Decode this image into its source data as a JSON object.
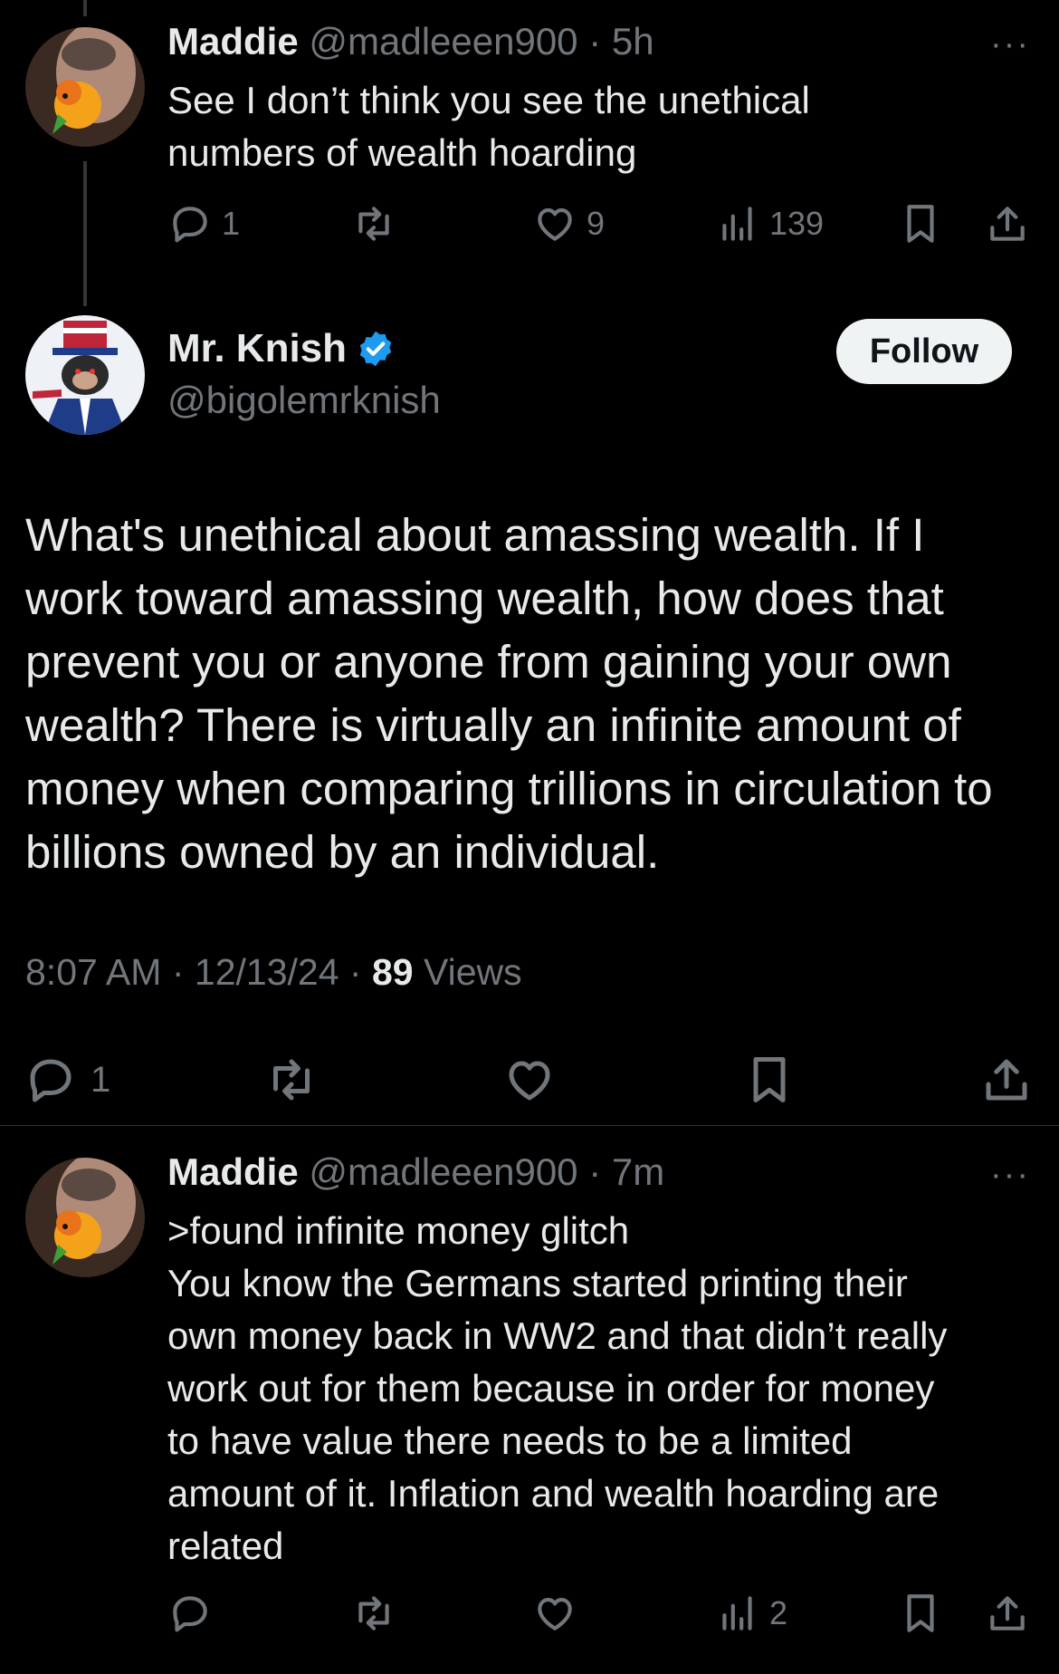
{
  "reply1": {
    "name": "Maddie",
    "handle": "@madleeen900",
    "time": "5h",
    "text_lines": [
      "See I don’t think you see the unethical",
      "numbers of wealth hoarding"
    ],
    "more": "···",
    "reply_count": "1",
    "like_count": "9",
    "view_count": "139"
  },
  "main": {
    "name": "Mr. Knish",
    "handle": "@bigolemrknish",
    "follow_label": "Follow",
    "text": "What's unethical about amassing wealth.  If I work toward amassing wealth, how does that prevent you or anyone from gaining your own wealth?  There is virtually an infinite amount of money when comparing trillions in circulation to billions owned by an individual.",
    "time": "8:07 AM",
    "date": "12/13/24",
    "views_count": "89",
    "views_label": "Views",
    "reply_count": "1",
    "verified_color": "#1d9bf0"
  },
  "reply2": {
    "name": "Maddie",
    "handle": "@madleeen900",
    "time": "7m",
    "text_lines": [
      ">found infinite money glitch",
      "You know the Germans started printing their",
      "own money back in WW2 and that didn’t really",
      "work out for them because in order for money",
      "to have value there needs to be a limited",
      "amount of it. Inflation and wealth hoarding are",
      "related"
    ],
    "more": "···",
    "view_count": "2"
  },
  "sep": "·"
}
